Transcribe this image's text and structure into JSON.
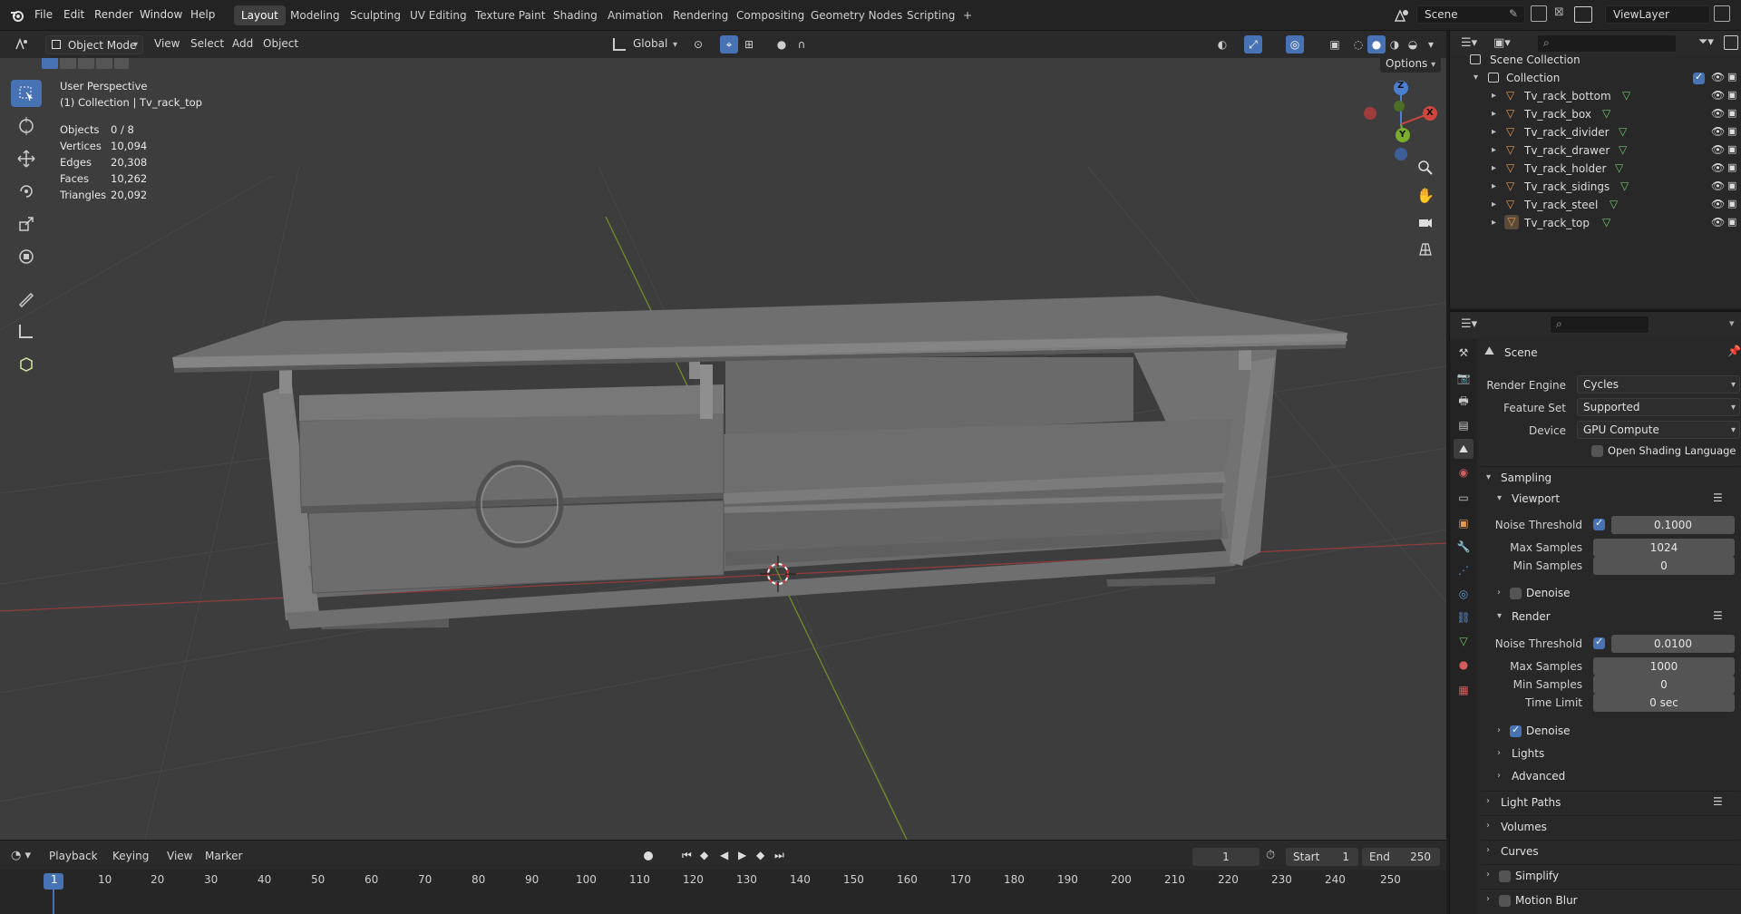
{
  "menubar": {
    "items": [
      "File",
      "Edit",
      "Render",
      "Window",
      "Help"
    ],
    "workspaces": [
      "Layout",
      "Modeling",
      "Sculpting",
      "UV Editing",
      "Texture Paint",
      "Shading",
      "Animation",
      "Rendering",
      "Compositing",
      "Geometry Nodes",
      "Scripting"
    ],
    "active_workspace": "Layout",
    "add_tab": "+",
    "scene_name": "Scene",
    "view_layer": "ViewLayer"
  },
  "viewport_header": {
    "mode": "Object Mode",
    "menus": [
      "View",
      "Select",
      "Add",
      "Object"
    ],
    "transform_orientation": "Global",
    "options_label": "Options"
  },
  "viewport": {
    "perspective": "User Perspective",
    "collection_info": "(1) Collection | Tv_rack_top",
    "stats": [
      {
        "label": "Objects",
        "value": "0 / 8"
      },
      {
        "label": "Vertices",
        "value": "10,094"
      },
      {
        "label": "Edges",
        "value": "20,308"
      },
      {
        "label": "Faces",
        "value": "10,262"
      },
      {
        "label": "Triangles",
        "value": "20,092"
      }
    ],
    "gizmo_axes": {
      "z": "Z",
      "y": "Y",
      "x": "X"
    }
  },
  "timeline": {
    "menus": [
      "Playback",
      "Keying",
      "View",
      "Marker"
    ],
    "current_frame": "1",
    "start_label": "Start",
    "start_value": "1",
    "end_label": "End",
    "end_value": "250",
    "ruler": [
      "1",
      "10",
      "20",
      "30",
      "40",
      "50",
      "60",
      "70",
      "80",
      "90",
      "100",
      "110",
      "120",
      "130",
      "140",
      "150",
      "160",
      "170",
      "180",
      "190",
      "200",
      "210",
      "220",
      "230",
      "240",
      "250"
    ]
  },
  "outliner": {
    "scene_collection": "Scene Collection",
    "collection": "Collection",
    "objects": [
      "Tv_rack_bottom",
      "Tv_rack_box",
      "Tv_rack_divider",
      "Tv_rack_drawer",
      "Tv_rack_holder",
      "Tv_rack_sidings",
      "Tv_rack_steel",
      "Tv_rack_top"
    ],
    "active_object": "Tv_rack_top"
  },
  "properties": {
    "context": "Scene",
    "render_engine_label": "Render Engine",
    "render_engine": "Cycles",
    "feature_set_label": "Feature Set",
    "feature_set": "Supported",
    "device_label": "Device",
    "device": "GPU Compute",
    "osl_label": "Open Shading Language",
    "sampling": {
      "title": "Sampling",
      "viewport": {
        "title": "Viewport",
        "noise_threshold_label": "Noise Threshold",
        "noise_threshold": "0.1000",
        "max_samples_label": "Max Samples",
        "max_samples": "1024",
        "min_samples_label": "Min Samples",
        "min_samples": "0",
        "denoise_label": "Denoise"
      },
      "render": {
        "title": "Render",
        "noise_threshold_label": "Noise Threshold",
        "noise_threshold": "0.0100",
        "max_samples_label": "Max Samples",
        "max_samples": "1000",
        "min_samples_label": "Min Samples",
        "min_samples": "0",
        "time_limit_label": "Time Limit",
        "time_limit": "0 sec",
        "denoise_label": "Denoise"
      },
      "lights": "Lights",
      "advanced": "Advanced"
    },
    "sections": [
      "Light Paths",
      "Volumes",
      "Curves",
      "Simplify",
      "Motion Blur"
    ]
  }
}
